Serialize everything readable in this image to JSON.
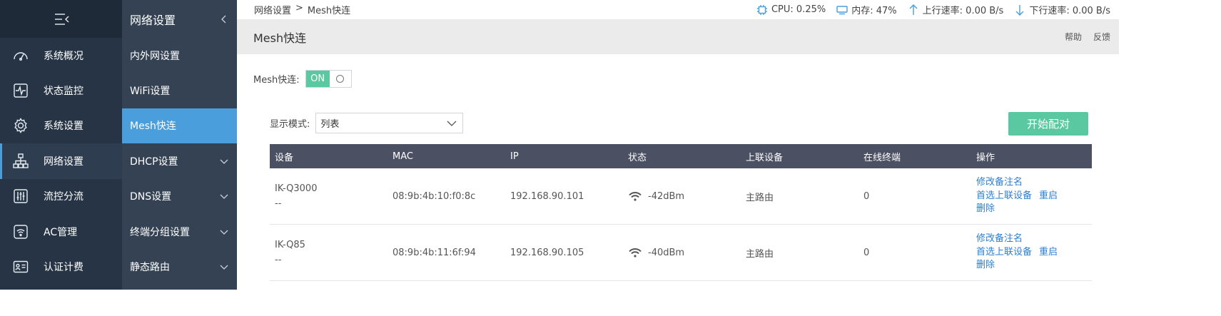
{
  "sidebar": {
    "collapse_icon": "menu-collapse-icon",
    "items": [
      {
        "label": "系统概况",
        "icon": "dashboard-icon"
      },
      {
        "label": "状态监控",
        "icon": "pulse-monitor-icon"
      },
      {
        "label": "系统设置",
        "icon": "gear-icon"
      },
      {
        "label": "网络设置",
        "icon": "network-icon",
        "active": true
      },
      {
        "label": "流控分流",
        "icon": "sliders-icon"
      },
      {
        "label": "AC管理",
        "icon": "wifi-ac-icon"
      },
      {
        "label": "认证计费",
        "icon": "id-card-icon"
      }
    ]
  },
  "subnav": {
    "title": "网络设置",
    "items": [
      {
        "label": "内外网设置"
      },
      {
        "label": "WiFi设置"
      },
      {
        "label": "Mesh快连",
        "active": true
      },
      {
        "label": "DHCP设置",
        "expandable": true
      },
      {
        "label": "DNS设置",
        "expandable": true
      },
      {
        "label": "终端分组设置",
        "expandable": true
      },
      {
        "label": "静态路由",
        "expandable": true
      }
    ]
  },
  "topbar": {
    "breadcrumb": [
      "网络设置",
      ">",
      "Mesh快连"
    ],
    "cpu": "CPU: 0.25%",
    "memory": "内存: 47%",
    "upload": "上行速率: 0.00 B/s",
    "download": "下行速率: 0.00 B/s"
  },
  "titlebar": {
    "title": "Mesh快连",
    "help": "帮助",
    "feedback": "反馈"
  },
  "mesh": {
    "label": "Mesh快连:",
    "switch_on": "ON",
    "enabled": true
  },
  "display": {
    "label": "显示模式:",
    "selected": "列表"
  },
  "pair_button": "开始配对",
  "table": {
    "headers": [
      "设备",
      "MAC",
      "IP",
      "状态",
      "上联设备",
      "在线终端",
      "操作"
    ],
    "rows": [
      {
        "device": "IK-Q3000",
        "remark": "--",
        "mac": "08:9b:4b:10:f0:8c",
        "ip": "192.168.90.101",
        "signal": "-42dBm",
        "uplink": "主路由",
        "online": "0"
      },
      {
        "device": "IK-Q85",
        "remark": "--",
        "mac": "08:9b:4b:11:6f:94",
        "ip": "192.168.90.105",
        "signal": "-40dBm",
        "uplink": "主路由",
        "online": "0"
      }
    ],
    "ops": {
      "edit_remark": "修改备注名",
      "prefer_uplink": "首选上联设备",
      "reboot": "重启",
      "delete": "删除"
    }
  },
  "colors": {
    "sidebar_bg": "#263445",
    "subnav_bg": "#344254",
    "active_blue": "#4a9edb",
    "green": "#5ac8a0",
    "table_header": "#4b5163",
    "link": "#2d7fd0"
  }
}
